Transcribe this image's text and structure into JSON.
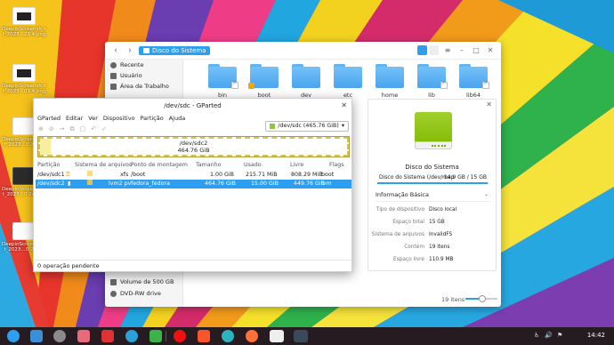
{
  "desktop": {
    "icons": [
      {
        "label": "DeepinScreensh ot_2023...23 4.png"
      },
      {
        "label": "DeepinScreensh ot_2023...03 4.png"
      },
      {
        "label": "DeepinScreensh ot_2023...0 2.png"
      },
      {
        "label": "DeepinScreensh ot_2023...0 24.png"
      },
      {
        "label": "DeepinScreensh ot_2023...0 2.png"
      }
    ]
  },
  "file_manager": {
    "breadcrumb": "Disco do Sistema",
    "sidebar": [
      {
        "label": "Recente",
        "icon": "clock-icon"
      },
      {
        "label": "Usuário",
        "icon": "home-icon"
      },
      {
        "label": "Área de Trabalho",
        "icon": "desktop-icon"
      },
      {
        "label": "Volume de 500 GB",
        "icon": "drive-icon"
      },
      {
        "label": "DVD-RW drive",
        "icon": "disc-icon"
      }
    ],
    "folders": [
      {
        "name": "bin",
        "link": true
      },
      {
        "name": "boot",
        "lock": true
      },
      {
        "name": "dev",
        "link": false
      },
      {
        "name": "etc",
        "link": false
      },
      {
        "name": "home",
        "link": false
      },
      {
        "name": "lib",
        "link": true
      },
      {
        "name": "lib64",
        "link": true
      }
    ],
    "item_count": "19 itens"
  },
  "detail": {
    "name": "Disco do Sistema",
    "path": "Disco do Sistema (/dev/map",
    "size": "14.9 GB / 15 GB",
    "usage_fraction": 0.99,
    "section_title": "Informação Básica",
    "properties": [
      {
        "key": "Tipo de dispositivo",
        "value": "Disco local"
      },
      {
        "key": "Espaço total",
        "value": "15 GB"
      },
      {
        "key": "Sistema de arquivos",
        "value": "InvalidFS"
      },
      {
        "key": "Contém",
        "value": "19 itens"
      },
      {
        "key": "Espaço livre",
        "value": "110.9 MB"
      }
    ]
  },
  "gparted": {
    "title": "/dev/sdc - GParted",
    "menu": [
      "GParted",
      "Editar",
      "Ver",
      "Dispositivo",
      "Partição",
      "Ajuda"
    ],
    "device": "/dev/sdc  (465.76 GiB)",
    "graph": {
      "name": "/dev/sdc2",
      "size": "464.76 GiB"
    },
    "columns": [
      "Partição",
      "Sistema de arquivos",
      "Ponto de montagem",
      "Tamanho",
      "Usado",
      "Livre",
      "Flags"
    ],
    "rows": [
      {
        "part": "/dev/sdc1",
        "fs": "xfs",
        "mount": "/boot",
        "size": "1.00 GiB",
        "used": "215.71 MiB",
        "free": "808.29 MiB",
        "flags": "boot",
        "selected": false
      },
      {
        "part": "/dev/sdc2",
        "fs": "lvm2 pv",
        "mount": "fedora_fedora",
        "size": "464.76 GiB",
        "used": "15.00 GiB",
        "free": "449.76 GiB",
        "flags": "lvm",
        "selected": true
      }
    ],
    "status": "0 operação pendente"
  },
  "taskbar": {
    "clock": "14:42"
  }
}
